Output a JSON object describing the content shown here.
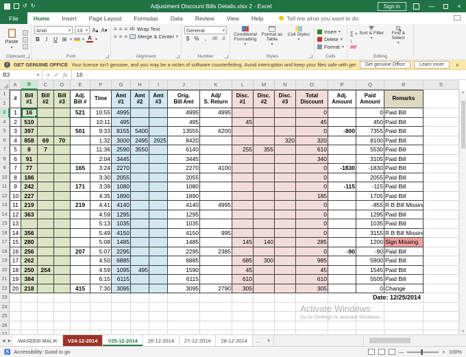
{
  "title_bar": {
    "title": "Adjustment Discount Bills Details.xlsx 2 - Excel",
    "sign_in": "Sign in"
  },
  "ribbon": {
    "tabs": [
      "File",
      "Home",
      "Insert",
      "Page Layout",
      "Formulas",
      "Data",
      "Review",
      "View",
      "Help"
    ],
    "active_tab": "Home",
    "tell_me": "Tell me what you want to do",
    "clipboard": {
      "label": "Clipboard",
      "paste": "Paste"
    },
    "font": {
      "label": "Font",
      "name": "Arial",
      "size": "13"
    },
    "alignment": {
      "label": "Alignment",
      "wrap_text": "Wrap Text",
      "merge_center": "Merge & Center"
    },
    "number": {
      "label": "Number",
      "format": "General"
    },
    "styles": {
      "label": "Styles",
      "conditional": "Conditional Formatting",
      "format_table": "Format as Table",
      "cell_styles": "Cell Styles"
    },
    "cells": {
      "label": "Cells",
      "insert": "Insert",
      "delete": "Delete",
      "format": "Format"
    },
    "editing": {
      "label": "Editing",
      "sort_filter": "Sort & Filter",
      "find_select": "Find & Select"
    }
  },
  "notice": {
    "badge": "GET GENUINE OFFICE",
    "message": "Your license isn't genuine, and you may be a victim of software counterfeiting. Avoid interruption and keep your files safe with genuine Office today.",
    "get_button": "Get genuine Office",
    "learn_button": "Learn more"
  },
  "formula_bar": {
    "name_box": "B3",
    "value": "16"
  },
  "sheet": {
    "columns": [
      "A",
      "B",
      "C",
      "D",
      "E",
      "F",
      "G",
      "H",
      "I",
      "J",
      "K",
      "L",
      "M",
      "N",
      "O",
      "P",
      "Q",
      "R",
      "S"
    ],
    "header": [
      "#",
      "Bill\n#1",
      "Bill\n#2",
      "Bill\n#3",
      "Adj.\nBill #",
      "Time",
      "Amt\n#1",
      "Amt\n#2",
      "Amt\n#3",
      "Orig.\nBill Amt",
      "Adj/\nS. Return",
      "Disc.\n#1",
      "Disc.\n#2",
      "Disc.\n#3",
      "Total\nDiscount",
      "Adj.\nAmount",
      "Paid\nAmount",
      "Remarks"
    ],
    "rows": [
      [
        "1",
        "16",
        "",
        "",
        "521",
        "10:55",
        "4995",
        "",
        "",
        "4995",
        "4995",
        "",
        "",
        "",
        "0",
        "",
        "0",
        "Paid Bill"
      ],
      [
        "2",
        "510",
        "",
        "",
        "",
        "10:11",
        "495",
        "",
        "",
        "495",
        "",
        "45",
        "",
        "",
        "45",
        "",
        "450",
        "Paid Bill"
      ],
      [
        "3",
        "397",
        "",
        "",
        "501",
        "9:33",
        "8155",
        "5400",
        "",
        "13555",
        "6200",
        "",
        "",
        "",
        "0",
        "-800",
        "7355",
        "Paid Bill"
      ],
      [
        "4",
        "858",
        "69",
        "70",
        "",
        "1:32",
        "3000",
        "2495",
        "2925",
        "8420",
        "",
        "",
        "",
        "320",
        "320",
        "",
        "8100",
        "Paid Bill"
      ],
      [
        "5",
        "8",
        "7",
        "",
        "",
        "11:36",
        "2590",
        "3550",
        "",
        "6140",
        "",
        "255",
        "355",
        "",
        "610",
        "",
        "5530",
        "Paid Bill"
      ],
      [
        "6",
        "91",
        "",
        "",
        "",
        "2:04",
        "3445",
        "",
        "",
        "3445",
        "",
        "",
        "",
        "",
        "340",
        "",
        "3105",
        "Paid Bill"
      ],
      [
        "7",
        "77",
        "",
        "",
        "165",
        "3:24",
        "2270",
        "",
        "",
        "2270",
        "4100",
        "",
        "",
        "",
        "0",
        "-1830",
        "-1830",
        "Paid Bill"
      ],
      [
        "8",
        "186",
        "",
        "",
        "",
        "3:30",
        "2055",
        "",
        "",
        "2055",
        "",
        "",
        "",
        "",
        "0",
        "",
        "2055",
        "Paid Bill"
      ],
      [
        "9",
        "242",
        "",
        "",
        "171",
        "3:39",
        "1080",
        "",
        "",
        "1080",
        "",
        "",
        "",
        "",
        "0",
        "-115",
        "-115",
        "Paid Bill"
      ],
      [
        "10",
        "227",
        "",
        "",
        "",
        "4:35",
        "1890",
        "",
        "",
        "1890",
        "",
        "",
        "",
        "",
        "185",
        "",
        "1705",
        "Paid Bill"
      ],
      [
        "11",
        "219",
        "",
        "",
        "219",
        "4:41",
        "4140",
        "",
        "",
        "4140",
        "4995",
        "",
        "",
        "",
        "0",
        "",
        "-855",
        "R B Bill Missing"
      ],
      [
        "12",
        "363",
        "",
        "",
        "",
        "4:59",
        "1295",
        "",
        "",
        "1295",
        "",
        "",
        "",
        "",
        "0",
        "",
        "1295",
        "Paid Bill"
      ],
      [
        "13",
        "",
        "",
        "",
        "",
        "5:13",
        "1035",
        "",
        "",
        "1035",
        "",
        "",
        "",
        "",
        "0",
        "",
        "1035",
        "Paid Bill"
      ],
      [
        "14",
        "356",
        "",
        "",
        "",
        "5:49",
        "4150",
        "",
        "",
        "4150",
        "995",
        "",
        "",
        "",
        "0",
        "",
        "3155",
        "R B Bill Missing"
      ],
      [
        "15",
        "280",
        "",
        "",
        "",
        "5:08",
        "1485",
        "",
        "",
        "1485",
        "",
        "145",
        "140",
        "",
        "285",
        "",
        "1200",
        "Sign  Missing"
      ],
      [
        "16",
        "256",
        "",
        "",
        "207",
        "5:07",
        "2295",
        "",
        "",
        "2295",
        "2385",
        "",
        "",
        "",
        "0",
        "-90",
        "-90",
        "Paid Bill"
      ],
      [
        "17",
        "262",
        "",
        "",
        "",
        "4:50",
        "6885",
        "",
        "",
        "6885",
        "",
        "685",
        "300",
        "",
        "985",
        "",
        "5900",
        "Paid Bill"
      ],
      [
        "18",
        "250",
        "254",
        "",
        "",
        "4:59",
        "1095",
        "495",
        "",
        "1590",
        "",
        "45",
        "",
        "",
        "45",
        "",
        "1545",
        "Paid Bill"
      ],
      [
        "19",
        "384",
        "",
        "",
        "",
        "6:15",
        "6115",
        "",
        "",
        "6115",
        "",
        "610",
        "",
        "",
        "610",
        "",
        "5505",
        "Paid Bill"
      ],
      [
        "20",
        "218",
        "",
        "",
        "415",
        "7:30",
        "3095",
        "",
        "",
        "3095",
        "2790",
        "305",
        "",
        "",
        "305",
        "",
        "0",
        "Change"
      ]
    ],
    "date_label": "Date: 12/25/2014",
    "selection": {
      "cell": "B3",
      "value": "16"
    },
    "colors": {
      "titlebar": "#217346",
      "green": "#dbe5c5",
      "blue": "#d2e7f0",
      "pink": "#f2dcdb",
      "remarks_header": "#ddd9c3",
      "alert": "#f2a1a1"
    }
  },
  "sheet_tabs": {
    "tabs": [
      {
        "name": "WASEEM MALIK",
        "color": "plain"
      },
      {
        "name": "V24-12-2014",
        "color": "red"
      },
      {
        "name": "V25-12-2014",
        "color": "green"
      },
      {
        "name": "26-12-2014",
        "color": "plain"
      },
      {
        "name": "27-12-2014",
        "color": "plain"
      },
      {
        "name": "28-12-2014",
        "color": "plain"
      }
    ],
    "overflow": "...",
    "add": "+"
  },
  "status_bar": {
    "accessibility": "Accessibility: Good to go",
    "zoom": "100%"
  },
  "watermark": {
    "line1": "Activate Windows",
    "line2": "Go to Settings to activate Windows."
  },
  "icons": {
    "dropdown": "▾",
    "undo": "↺",
    "redo": "↻",
    "close": "×",
    "minimize": "—",
    "bold": "B",
    "italic": "I",
    "underline": "U",
    "borders": "⊞",
    "font_color": "A",
    "grow_font": "A▴",
    "shrink_font": "A▾",
    "align_lines": "≡",
    "dollar": "$",
    "percent": "%",
    "comma": ",",
    "dec_inc": ".00",
    "dec_dec": ".0",
    "autosum": "∑",
    "fill_down": "↓",
    "sort_az": "AZ",
    "fx": "fx",
    "check": "✓",
    "cancel": "×",
    "prev": "◀",
    "next": "▶",
    "accessibility": "♿",
    "zoom_in": "+",
    "zoom_out": "—",
    "info": "i",
    "wrap_ab": "ab"
  }
}
